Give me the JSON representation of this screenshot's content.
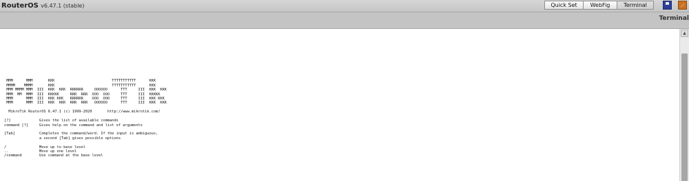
{
  "header": {
    "app_name": "RouterOS",
    "version": "v6.47.1 (stable)",
    "modes": [
      {
        "label": "Quick Set",
        "active": false
      },
      {
        "label": "WebFig",
        "active": false
      },
      {
        "label": "Terminal",
        "active": true
      }
    ],
    "icons": [
      "save-icon",
      "winbox-icon"
    ]
  },
  "section_title": "Terminal",
  "terminal": {
    "lines": [
      "",
      "",
      "",
      "",
      "",
      "",
      " MMM      MMM       KKK                          TTTTTTTTTTT      KKK",
      " MMMM    MMMM       KKK                          TTTTTTTTTTT      KKK",
      " MMM MMMM MMM  III  KKK  KKK  RRRRRR     OOOOOO      TTT     III  KKK  KKK",
      " MMM  MM  MMM  III  KKKKK     RRR  RRR  OOO  OOO     TTT     III  KKKKK",
      " MMM      MMM  III  KKK KKK   RRRRRR    OOO  OOO     TTT     III  KKK KKK",
      " MMM      MMM  III  KKK  KKK  RRR  RRR   OOOOOO      TTT     III  KKK  KKK",
      "",
      "  MikroTik RouterOS 6.47.1 (c) 1999-2020       http://www.mikrotik.com/",
      "",
      "[?]             Gives the list of available commands",
      "command [?]     Gives help on the command and list of arguments",
      "",
      "[Tab]           Completes the command/word. If the input is ambiguous,",
      "                a second [Tab] gives possible options",
      "",
      "/               Move up to base level",
      "..              Move up one level",
      "/command        Use command at the base level"
    ]
  },
  "colors": {
    "chrome": "#c8c8c8",
    "terminal_bg": "#ffffff",
    "terminal_text": "#111111",
    "save_icon": "#2c3f97",
    "winbox_icon": "#c9701f"
  }
}
